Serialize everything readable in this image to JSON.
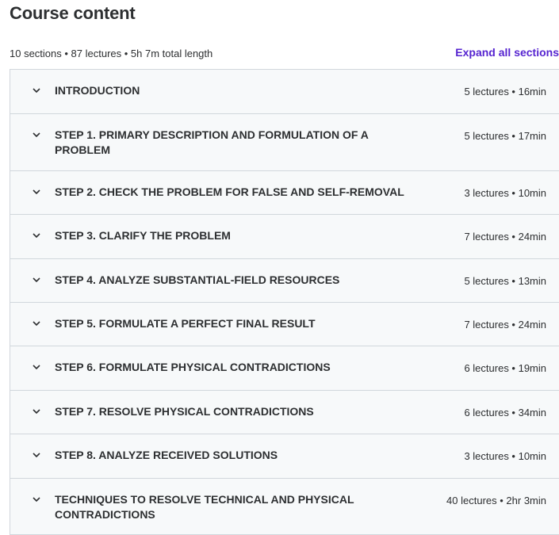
{
  "header": {
    "title": "Course content",
    "summary": "10 sections • 87 lectures • 5h 7m total length",
    "expand_label": "Expand all sections"
  },
  "sections": [
    {
      "title": "INTRODUCTION",
      "meta": "5 lectures • 16min"
    },
    {
      "title": "STEP 1. PRIMARY DESCRIPTION AND FORMULATION OF A PROBLEM",
      "meta": "5 lectures • 17min"
    },
    {
      "title": "STEP 2. CHECK THE PROBLEM FOR FALSE AND SELF-REMOVAL",
      "meta": "3 lectures • 10min"
    },
    {
      "title": "STEP 3. CLARIFY THE PROBLEM",
      "meta": "7 lectures • 24min"
    },
    {
      "title": "STEP 4. ANALYZE SUBSTANTIAL-FIELD RESOURCES",
      "meta": "5 lectures • 13min"
    },
    {
      "title": "STEP 5. FORMULATE A PERFECT FINAL RESULT",
      "meta": "7 lectures • 24min"
    },
    {
      "title": "STEP 6. FORMULATE PHYSICAL CONTRADICTIONS",
      "meta": "6 lectures • 19min"
    },
    {
      "title": "STEP 7. RESOLVE PHYSICAL CONTRADICTIONS",
      "meta": "6 lectures • 34min"
    },
    {
      "title": "STEP 8. ANALYZE RECEIVED SOLUTIONS",
      "meta": "3 lectures • 10min"
    },
    {
      "title": "TECHNIQUES TO RESOLVE TECHNICAL AND PHYSICAL CONTRADICTIONS",
      "meta": "40 lectures • 2hr 3min"
    }
  ],
  "icons": {
    "section_toggle": "chevron-down-icon"
  },
  "colors": {
    "accent": "#5624d0",
    "row_bg": "#f7f9fa",
    "border": "#d1d7dc",
    "text": "#2d2f31"
  }
}
